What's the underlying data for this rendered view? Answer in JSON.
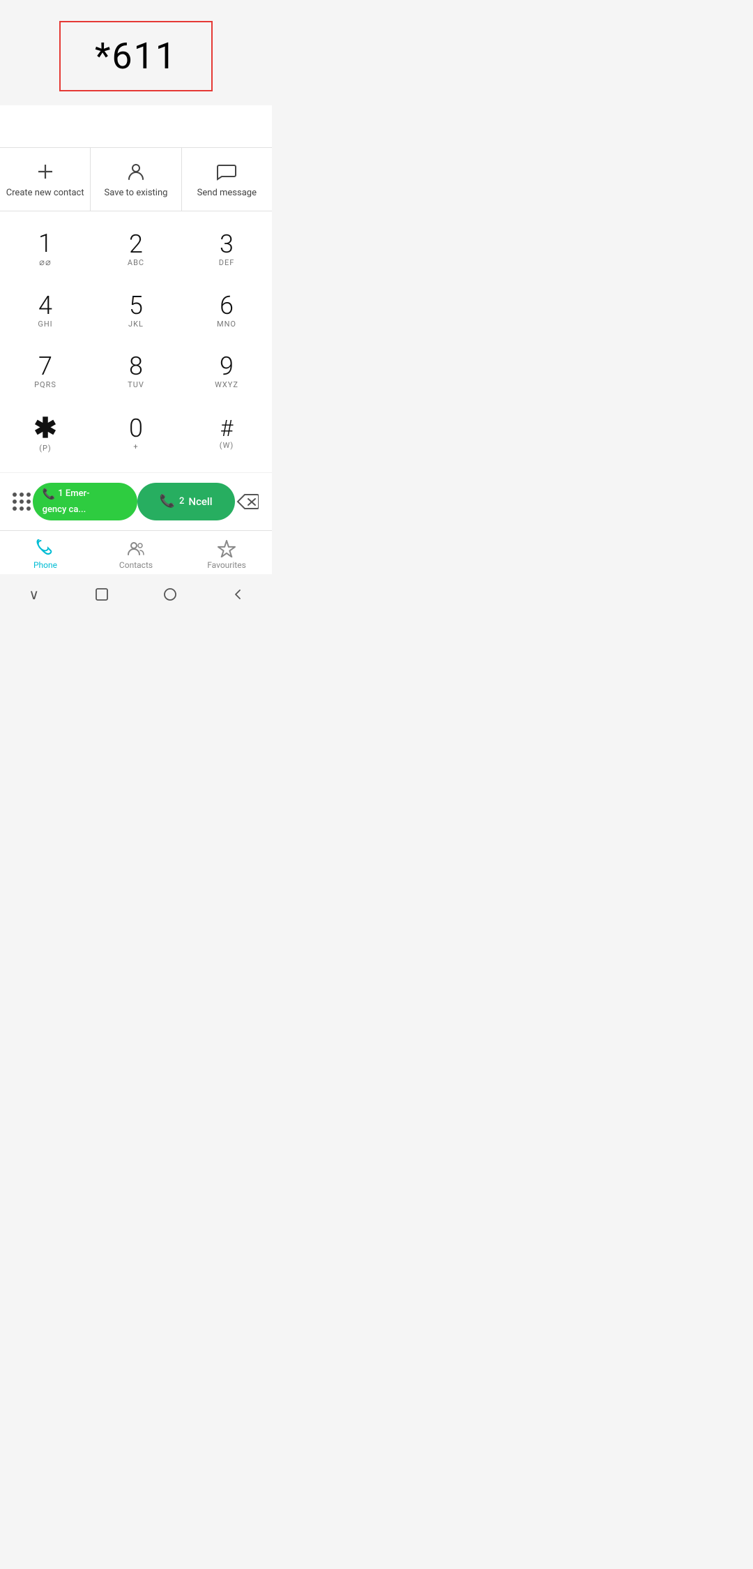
{
  "dialpad": {
    "number": "*611",
    "keys": [
      {
        "number": "1",
        "letters": "◌◌",
        "id": "key-1"
      },
      {
        "number": "2",
        "letters": "ABC",
        "id": "key-2"
      },
      {
        "number": "3",
        "letters": "DEF",
        "id": "key-3"
      },
      {
        "number": "4",
        "letters": "GHI",
        "id": "key-4"
      },
      {
        "number": "5",
        "letters": "JKL",
        "id": "key-5"
      },
      {
        "number": "6",
        "letters": "MNO",
        "id": "key-6"
      },
      {
        "number": "7",
        "letters": "PQRS",
        "id": "key-7"
      },
      {
        "number": "8",
        "letters": "TUV",
        "id": "key-8"
      },
      {
        "number": "9",
        "letters": "WXYZ",
        "id": "key-9"
      },
      {
        "number": "*",
        "letters": "(P)",
        "id": "key-star"
      },
      {
        "number": "0",
        "letters": "+",
        "id": "key-0"
      },
      {
        "number": "#",
        "letters": "(W)",
        "id": "key-hash"
      }
    ]
  },
  "actions": {
    "create_new_contact": "Create new contact",
    "save_to_existing": "Save to existing",
    "send_message": "Send message"
  },
  "call_buttons": {
    "emergency": {
      "label1": "1 Emer-",
      "label2": "gency ca..."
    },
    "ncell": {
      "number": "2",
      "label": "Ncell"
    }
  },
  "bottom_nav": {
    "items": [
      {
        "label": "Phone",
        "id": "phone",
        "active": true
      },
      {
        "label": "Contacts",
        "id": "contacts",
        "active": false
      },
      {
        "label": "Favourites",
        "id": "favourites",
        "active": false
      }
    ]
  },
  "system_nav": {
    "back": "◁",
    "home": "○",
    "recents": "□",
    "dropdown": "∨"
  }
}
